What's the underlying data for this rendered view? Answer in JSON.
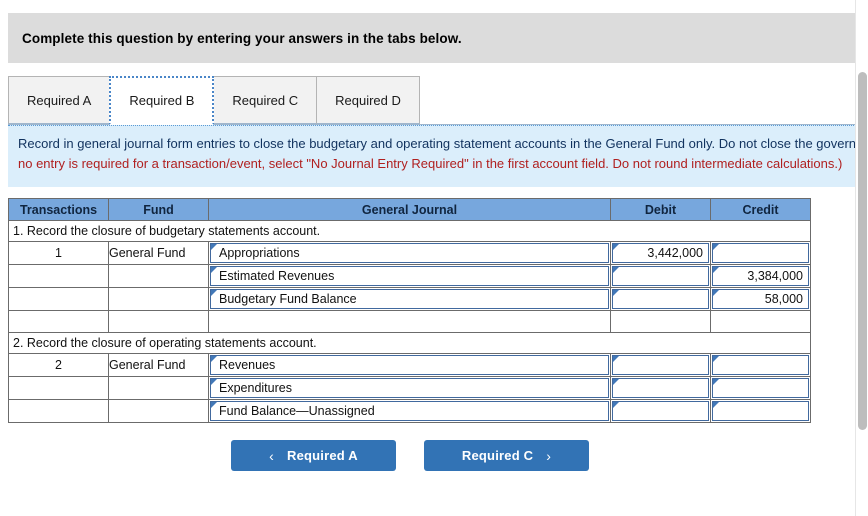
{
  "banner": {
    "title": "Complete this question by entering your answers in the tabs below."
  },
  "tabs": [
    {
      "label": "Required A",
      "active": false
    },
    {
      "label": "Required B",
      "active": true
    },
    {
      "label": "Required C",
      "active": false
    },
    {
      "label": "Required D",
      "active": false
    }
  ],
  "instructions": {
    "main": "Record in general journal form entries to close the budgetary and operating statement accounts in the General Fund only. Do not close the governmental activities accounts.",
    "hint": "(If no entry is required for a transaction/event, select \"No Journal Entry Required\" in the first account field. Do not round intermediate calculations.)"
  },
  "table": {
    "headers": [
      "Transactions",
      "Fund",
      "General Journal",
      "Debit",
      "Credit"
    ],
    "sections": [
      {
        "title": "1. Record the closure of budgetary statements account.",
        "rows": [
          {
            "transaction": "1",
            "fund": "General Fund",
            "account": "Appropriations",
            "debit": "3,442,000",
            "credit": ""
          },
          {
            "transaction": "",
            "fund": "",
            "account": "Estimated Revenues",
            "debit": "",
            "credit": "3,384,000"
          },
          {
            "transaction": "",
            "fund": "",
            "account": "Budgetary Fund Balance",
            "debit": "",
            "credit": "58,000"
          },
          {
            "transaction": "",
            "fund": "",
            "account": null,
            "debit": null,
            "credit": null
          }
        ]
      },
      {
        "title": "2. Record the closure of operating statements account.",
        "rows": [
          {
            "transaction": "2",
            "fund": "General Fund",
            "account": "Revenues",
            "debit": "",
            "credit": ""
          },
          {
            "transaction": "",
            "fund": "",
            "account": "Expenditures",
            "debit": "",
            "credit": ""
          },
          {
            "transaction": "",
            "fund": "",
            "account": "Fund Balance—Unassigned",
            "debit": "",
            "credit": ""
          }
        ]
      }
    ]
  },
  "nav": {
    "prev_chevron": "‹",
    "prev_label": "Required A",
    "next_label": "Required C",
    "next_chevron": "›"
  },
  "colors": {
    "table_header_blue": "#77a7dd",
    "button_blue": "#3273b5",
    "instruction_bg": "#dbeefb",
    "hint_red": "#b02020",
    "banner_grey": "#dcdcdc"
  }
}
